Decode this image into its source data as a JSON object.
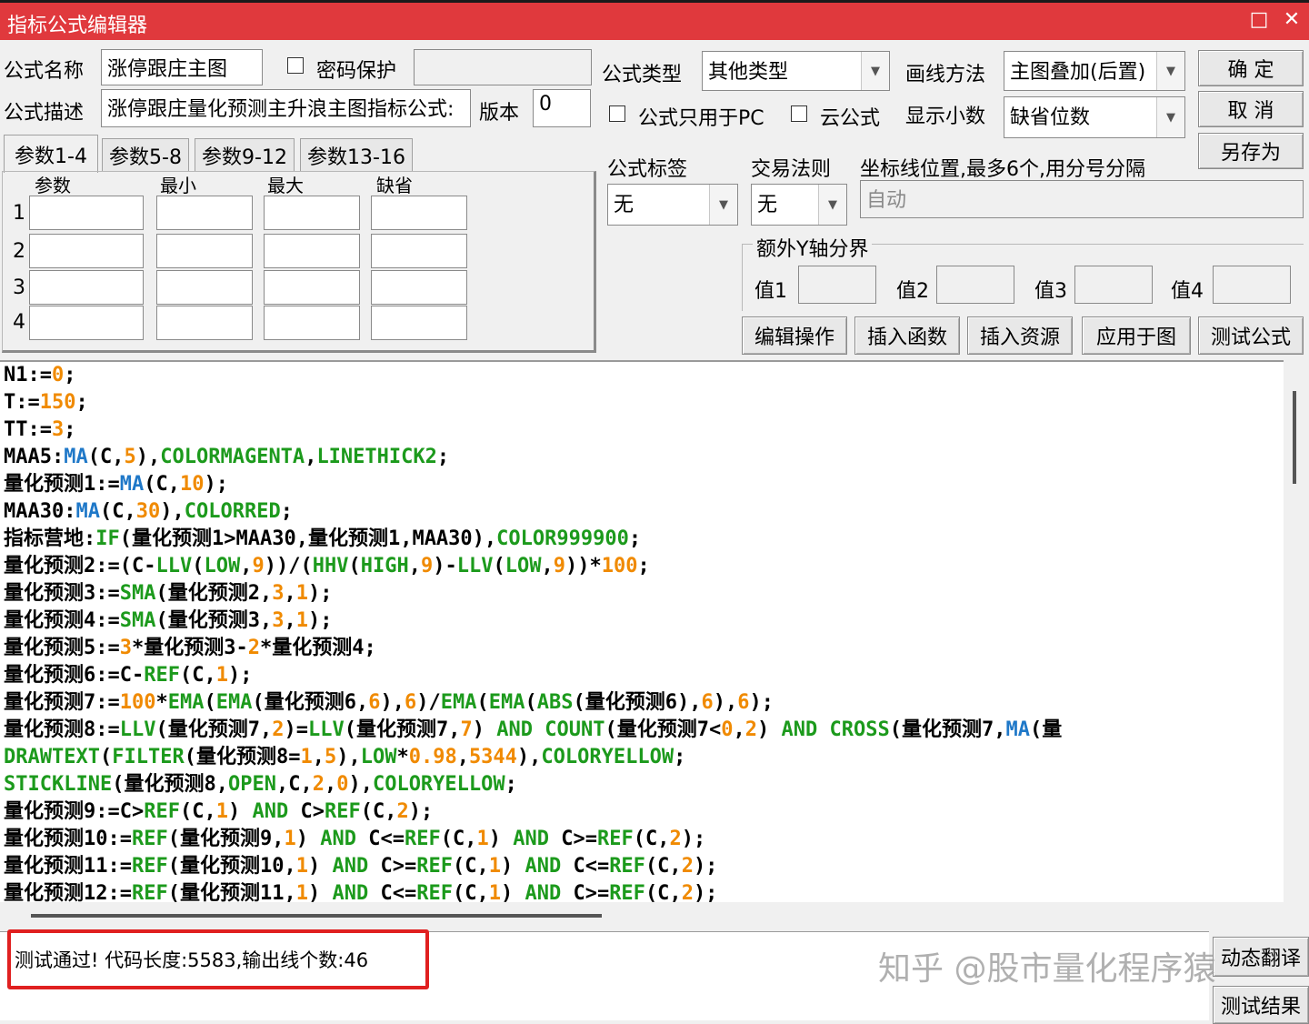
{
  "window": {
    "title": "指标公式编辑器",
    "maximize_icon": "□",
    "close_icon": "✕"
  },
  "form": {
    "name_label": "公式名称",
    "name_value": "涨停跟庄主图",
    "password_label": "密码保护",
    "desc_label": "公式描述",
    "desc_value": "涨停跟庄量化预测主升浪主图指标公式:",
    "version_label": "版本",
    "version_value": "0",
    "type_label": "公式类型",
    "type_value": "其他类型",
    "draw_label": "画线方法",
    "draw_value": "主图叠加(后置)",
    "pc_only_label": "公式只用于PC",
    "cloud_label": "云公式",
    "decimals_label": "显示小数",
    "decimals_value": "缺省位数",
    "tag_label": "公式标签",
    "tag_value": "无",
    "rule_label": "交易法则",
    "rule_value": "无",
    "axis_label": "坐标线位置,最多6个,用分号分隔",
    "axis_placeholder": "自动",
    "extra_y_label": "额外Y轴分界",
    "v1": "值1",
    "v2": "值2",
    "v3": "值3",
    "v4": "值4"
  },
  "params": {
    "tabs": [
      "参数1-4",
      "参数5-8",
      "参数9-12",
      "参数13-16"
    ],
    "headers": [
      "参数",
      "最小",
      "最大",
      "缺省"
    ],
    "rows": [
      "1",
      "2",
      "3",
      "4"
    ]
  },
  "buttons": {
    "ok": "确 定",
    "cancel": "取 消",
    "save_as": "另存为",
    "edit": "编辑操作",
    "insert_func": "插入函数",
    "insert_res": "插入资源",
    "apply": "应用于图",
    "test": "测试公式",
    "auto_translate": "动态翻译",
    "test_result": "测试结果"
  },
  "code_lines": [
    [
      [
        "t",
        "N1:="
      ],
      [
        "n",
        "0"
      ],
      [
        "t",
        ";"
      ]
    ],
    [
      [
        "t",
        "T:="
      ],
      [
        "n",
        "150"
      ],
      [
        "t",
        ";"
      ]
    ],
    [
      [
        "t",
        "TT:="
      ],
      [
        "n",
        "3"
      ],
      [
        "t",
        ";"
      ]
    ],
    [
      [
        "t",
        "MAA5:"
      ],
      [
        "f",
        "MA"
      ],
      [
        "t",
        "(C,"
      ],
      [
        "n",
        "5"
      ],
      [
        "t",
        "),"
      ],
      [
        "k",
        "COLORMAGENTA"
      ],
      [
        "t",
        ","
      ],
      [
        "k",
        "LINETHICK2"
      ],
      [
        "t",
        ";"
      ]
    ],
    [
      [
        "t",
        "量化预测1:="
      ],
      [
        "f",
        "MA"
      ],
      [
        "t",
        "(C,"
      ],
      [
        "n",
        "10"
      ],
      [
        "t",
        ");"
      ]
    ],
    [
      [
        "t",
        "MAA30:"
      ],
      [
        "f",
        "MA"
      ],
      [
        "t",
        "(C,"
      ],
      [
        "n",
        "30"
      ],
      [
        "t",
        "),"
      ],
      [
        "k",
        "COLORRED"
      ],
      [
        "t",
        ";"
      ]
    ],
    [
      [
        "t",
        "指标营地:"
      ],
      [
        "k",
        "IF"
      ],
      [
        "t",
        "(量化预测1>MAA30,量化预测1,MAA30),"
      ],
      [
        "k",
        "COLOR999900"
      ],
      [
        "t",
        ";"
      ]
    ],
    [
      [
        "t",
        "量化预测2:=(C-"
      ],
      [
        "k",
        "LLV"
      ],
      [
        "t",
        "("
      ],
      [
        "k",
        "LOW"
      ],
      [
        "t",
        ","
      ],
      [
        "n",
        "9"
      ],
      [
        "t",
        "))/("
      ],
      [
        "k",
        "HHV"
      ],
      [
        "t",
        "("
      ],
      [
        "k",
        "HIGH"
      ],
      [
        "t",
        ","
      ],
      [
        "n",
        "9"
      ],
      [
        "t",
        ")-"
      ],
      [
        "k",
        "LLV"
      ],
      [
        "t",
        "("
      ],
      [
        "k",
        "LOW"
      ],
      [
        "t",
        ","
      ],
      [
        "n",
        "9"
      ],
      [
        "t",
        "))*"
      ],
      [
        "n",
        "100"
      ],
      [
        "t",
        ";"
      ]
    ],
    [
      [
        "t",
        "量化预测3:="
      ],
      [
        "k",
        "SMA"
      ],
      [
        "t",
        "(量化预测2,"
      ],
      [
        "n",
        "3"
      ],
      [
        "t",
        ","
      ],
      [
        "n",
        "1"
      ],
      [
        "t",
        ");"
      ]
    ],
    [
      [
        "t",
        "量化预测4:="
      ],
      [
        "k",
        "SMA"
      ],
      [
        "t",
        "(量化预测3,"
      ],
      [
        "n",
        "3"
      ],
      [
        "t",
        ","
      ],
      [
        "n",
        "1"
      ],
      [
        "t",
        ");"
      ]
    ],
    [
      [
        "t",
        "量化预测5:="
      ],
      [
        "n",
        "3"
      ],
      [
        "t",
        "*量化预测3-"
      ],
      [
        "n",
        "2"
      ],
      [
        "t",
        "*量化预测4;"
      ]
    ],
    [
      [
        "t",
        "量化预测6:=C-"
      ],
      [
        "k",
        "REF"
      ],
      [
        "t",
        "(C,"
      ],
      [
        "n",
        "1"
      ],
      [
        "t",
        ");"
      ]
    ],
    [
      [
        "t",
        "量化预测7:="
      ],
      [
        "n",
        "100"
      ],
      [
        "t",
        "*"
      ],
      [
        "k",
        "EMA"
      ],
      [
        "t",
        "("
      ],
      [
        "k",
        "EMA"
      ],
      [
        "t",
        "(量化预测6,"
      ],
      [
        "n",
        "6"
      ],
      [
        "t",
        "),"
      ],
      [
        "n",
        "6"
      ],
      [
        "t",
        ")/"
      ],
      [
        "k",
        "EMA"
      ],
      [
        "t",
        "("
      ],
      [
        "k",
        "EMA"
      ],
      [
        "t",
        "("
      ],
      [
        "k",
        "ABS"
      ],
      [
        "t",
        "(量化预测6),"
      ],
      [
        "n",
        "6"
      ],
      [
        "t",
        "),"
      ],
      [
        "n",
        "6"
      ],
      [
        "t",
        ");"
      ]
    ],
    [
      [
        "t",
        "量化预测8:="
      ],
      [
        "k",
        "LLV"
      ],
      [
        "t",
        "(量化预测7,"
      ],
      [
        "n",
        "2"
      ],
      [
        "t",
        ")="
      ],
      [
        "k",
        "LLV"
      ],
      [
        "t",
        "(量化预测7,"
      ],
      [
        "n",
        "7"
      ],
      [
        "t",
        ") "
      ],
      [
        "k",
        "AND"
      ],
      [
        "t",
        " "
      ],
      [
        "k",
        "COUNT"
      ],
      [
        "t",
        "(量化预测7<"
      ],
      [
        "n",
        "0"
      ],
      [
        "t",
        ","
      ],
      [
        "n",
        "2"
      ],
      [
        "t",
        ") "
      ],
      [
        "k",
        "AND"
      ],
      [
        "t",
        " "
      ],
      [
        "k",
        "CROSS"
      ],
      [
        "t",
        "(量化预测7,"
      ],
      [
        "f",
        "MA"
      ],
      [
        "t",
        "(量"
      ]
    ],
    [
      [
        "k",
        "DRAWTEXT"
      ],
      [
        "t",
        "("
      ],
      [
        "k",
        "FILTER"
      ],
      [
        "t",
        "(量化预测8="
      ],
      [
        "n",
        "1"
      ],
      [
        "t",
        ","
      ],
      [
        "n",
        "5"
      ],
      [
        "t",
        "),"
      ],
      [
        "k",
        "LOW"
      ],
      [
        "t",
        "*"
      ],
      [
        "n",
        "0.98"
      ],
      [
        "t",
        ","
      ],
      [
        "n",
        "5344"
      ],
      [
        "t",
        "),"
      ],
      [
        "k",
        "COLORYELLOW"
      ],
      [
        "t",
        ";"
      ]
    ],
    [
      [
        "k",
        "STICKLINE"
      ],
      [
        "t",
        "(量化预测8,"
      ],
      [
        "k",
        "OPEN"
      ],
      [
        "t",
        ",C,"
      ],
      [
        "n",
        "2"
      ],
      [
        "t",
        ","
      ],
      [
        "n",
        "0"
      ],
      [
        "t",
        "),"
      ],
      [
        "k",
        "COLORYELLOW"
      ],
      [
        "t",
        ";"
      ]
    ],
    [
      [
        "t",
        "量化预测9:=C>"
      ],
      [
        "k",
        "REF"
      ],
      [
        "t",
        "(C,"
      ],
      [
        "n",
        "1"
      ],
      [
        "t",
        ") "
      ],
      [
        "k",
        "AND"
      ],
      [
        "t",
        " C>"
      ],
      [
        "k",
        "REF"
      ],
      [
        "t",
        "(C,"
      ],
      [
        "n",
        "2"
      ],
      [
        "t",
        ");"
      ]
    ],
    [
      [
        "t",
        "量化预测10:="
      ],
      [
        "k",
        "REF"
      ],
      [
        "t",
        "(量化预测9,"
      ],
      [
        "n",
        "1"
      ],
      [
        "t",
        ") "
      ],
      [
        "k",
        "AND"
      ],
      [
        "t",
        " C<="
      ],
      [
        "k",
        "REF"
      ],
      [
        "t",
        "(C,"
      ],
      [
        "n",
        "1"
      ],
      [
        "t",
        ") "
      ],
      [
        "k",
        "AND"
      ],
      [
        "t",
        " C>="
      ],
      [
        "k",
        "REF"
      ],
      [
        "t",
        "(C,"
      ],
      [
        "n",
        "2"
      ],
      [
        "t",
        ");"
      ]
    ],
    [
      [
        "t",
        "量化预测11:="
      ],
      [
        "k",
        "REF"
      ],
      [
        "t",
        "(量化预测10,"
      ],
      [
        "n",
        "1"
      ],
      [
        "t",
        ") "
      ],
      [
        "k",
        "AND"
      ],
      [
        "t",
        " C>="
      ],
      [
        "k",
        "REF"
      ],
      [
        "t",
        "(C,"
      ],
      [
        "n",
        "1"
      ],
      [
        "t",
        ") "
      ],
      [
        "k",
        "AND"
      ],
      [
        "t",
        " C<="
      ],
      [
        "k",
        "REF"
      ],
      [
        "t",
        "(C,"
      ],
      [
        "n",
        "2"
      ],
      [
        "t",
        ");"
      ]
    ],
    [
      [
        "t",
        "量化预测12:="
      ],
      [
        "k",
        "REF"
      ],
      [
        "t",
        "(量化预测11,"
      ],
      [
        "n",
        "1"
      ],
      [
        "t",
        ") "
      ],
      [
        "k",
        "AND"
      ],
      [
        "t",
        " C<="
      ],
      [
        "k",
        "REF"
      ],
      [
        "t",
        "(C,"
      ],
      [
        "n",
        "1"
      ],
      [
        "t",
        ") "
      ],
      [
        "k",
        "AND"
      ],
      [
        "t",
        " C>="
      ],
      [
        "k",
        "REF"
      ],
      [
        "t",
        "(C,"
      ],
      [
        "n",
        "2"
      ],
      [
        "t",
        ");"
      ]
    ]
  ],
  "code_colors": {
    "text": "#000000",
    "number": "#f08a00",
    "function": "#1f78c8",
    "keyword": "#1c9a1c"
  },
  "status": {
    "message": "测试通过! 代码长度:5583,输出线个数:46"
  },
  "watermark": "知乎 @股市量化程序猿",
  "colors": {
    "titlebar": "#e0393d",
    "highlight_box": "#e02020"
  }
}
